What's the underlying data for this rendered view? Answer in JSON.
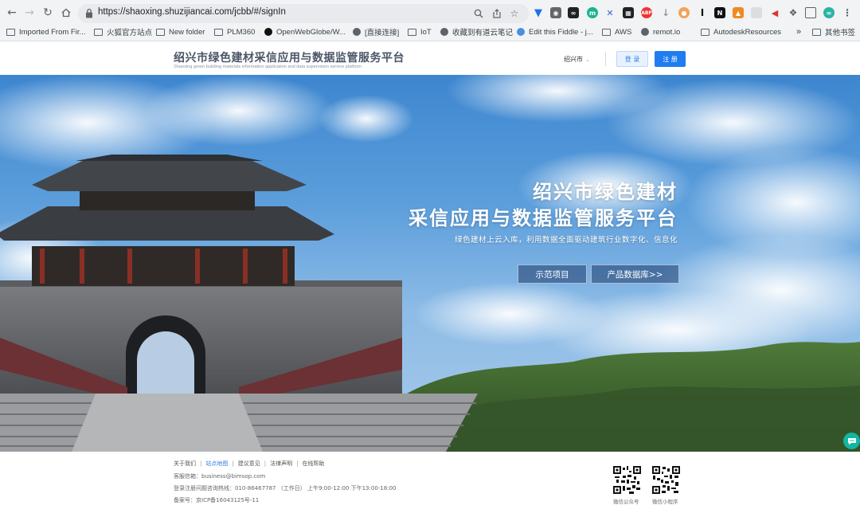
{
  "browser": {
    "url": "https://shaoxing.shuzijiancai.com/jcbb/#/signIn",
    "bookmarks": [
      {
        "label": "Imported From Fir...",
        "icon": "folder-icon"
      },
      {
        "label": "火狐官方站点",
        "icon": "folder-icon"
      },
      {
        "label": "New folder",
        "icon": "folder-icon"
      },
      {
        "label": "PLM360",
        "icon": "folder-icon"
      },
      {
        "label": "OpenWebGlobe/W...",
        "icon": "github-icon"
      },
      {
        "label": "[直接连接]",
        "icon": "globe-icon"
      },
      {
        "label": "IoT",
        "icon": "folder-icon"
      },
      {
        "label": "收藏到有道云笔记",
        "icon": "globe-icon"
      },
      {
        "label": "Edit this Fiddle - j...",
        "icon": "cloud-icon"
      },
      {
        "label": "AWS",
        "icon": "folder-icon"
      },
      {
        "label": "remot.io",
        "icon": "globe-icon"
      },
      {
        "label": "AutodeskResources",
        "icon": "folder-icon"
      }
    ],
    "more_bookmarks": "»",
    "other_bookmarks": "其他书签"
  },
  "header": {
    "title": "绍兴市绿色建材采信应用与数据监管服务平台",
    "subtitle": "Shaoxing green building materials information application and data supervision service platform",
    "city": "绍兴市",
    "login_label": "登 录",
    "register_label": "注 册"
  },
  "hero": {
    "title_line1": "绍兴市绿色建材",
    "title_line2": "采信应用与数据监管服务平台",
    "subtitle": "绿色建材上云入库，利用数据全面驱动建筑行业数字化、信息化",
    "demo_button": "示范项目",
    "database_button": "产品数据库>>"
  },
  "footer": {
    "links": [
      "关于我们",
      "站点地图",
      "建议意见",
      "法律声明",
      "在线帮助"
    ],
    "email": "客服信箱：business@bimsop.com",
    "hotline": "登录注册问题咨询热线：010-86467787 （工作日） 上午9:00-12:00 下午13:00-18:00",
    "icp": "备案号：京ICP备16043125号-11",
    "qr_official": "微信公众号",
    "qr_mini": "微信小程序"
  },
  "colors": {
    "primary": "#1f7cf1",
    "header_title": "#4a5566",
    "sky": "#5d9fdc"
  }
}
